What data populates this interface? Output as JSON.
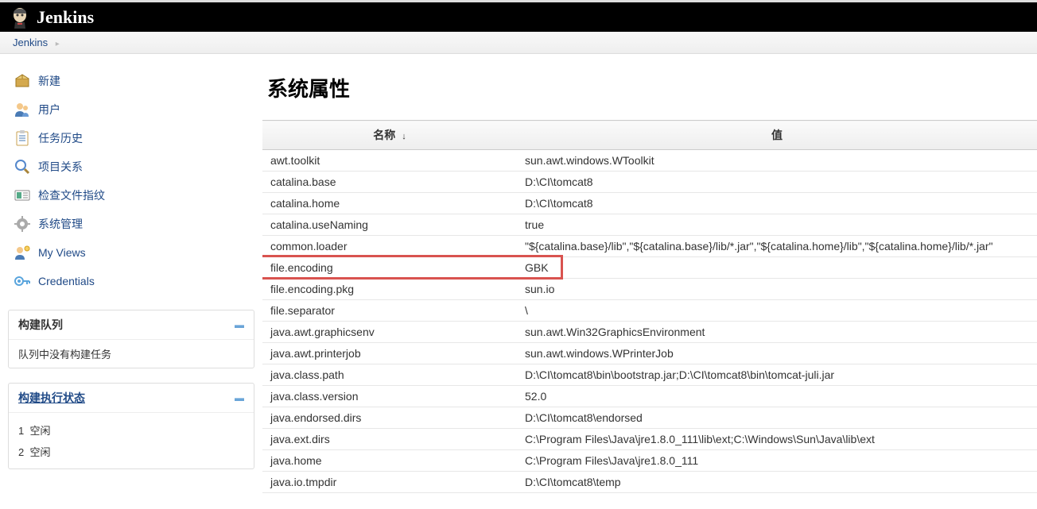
{
  "header": {
    "product_name": "Jenkins"
  },
  "breadcrumb": {
    "items": [
      "Jenkins"
    ]
  },
  "sidebar": {
    "items": [
      {
        "label": "新建",
        "icon": "box"
      },
      {
        "label": "用户",
        "icon": "users"
      },
      {
        "label": "任务历史",
        "icon": "clipboard"
      },
      {
        "label": "项目关系",
        "icon": "search"
      },
      {
        "label": "检查文件指纹",
        "icon": "fingerprint"
      },
      {
        "label": "系统管理",
        "icon": "gear"
      },
      {
        "label": "My Views",
        "icon": "myview"
      },
      {
        "label": "Credentials",
        "icon": "key"
      }
    ]
  },
  "panels": {
    "build_queue": {
      "title": "构建队列",
      "empty_msg": "队列中没有构建任务"
    },
    "executors": {
      "title": "构建执行状态",
      "rows": [
        {
          "num": "1",
          "state": "空闲"
        },
        {
          "num": "2",
          "state": "空闲"
        }
      ]
    }
  },
  "main": {
    "title": "系统属性",
    "columns": {
      "name": "名称",
      "value": "值"
    },
    "sort_indicator": "↓",
    "rows": [
      {
        "name": "awt.toolkit",
        "value": "sun.awt.windows.WToolkit"
      },
      {
        "name": "catalina.base",
        "value": "D:\\CI\\tomcat8"
      },
      {
        "name": "catalina.home",
        "value": "D:\\CI\\tomcat8"
      },
      {
        "name": "catalina.useNaming",
        "value": "true"
      },
      {
        "name": "common.loader",
        "value": "\"${catalina.base}/lib\",\"${catalina.base}/lib/*.jar\",\"${catalina.home}/lib\",\"${catalina.home}/lib/*.jar\""
      },
      {
        "name": "file.encoding",
        "value": "GBK",
        "highlighted": true
      },
      {
        "name": "file.encoding.pkg",
        "value": "sun.io"
      },
      {
        "name": "file.separator",
        "value": "\\"
      },
      {
        "name": "java.awt.graphicsenv",
        "value": "sun.awt.Win32GraphicsEnvironment"
      },
      {
        "name": "java.awt.printerjob",
        "value": "sun.awt.windows.WPrinterJob"
      },
      {
        "name": "java.class.path",
        "value": "D:\\CI\\tomcat8\\bin\\bootstrap.jar;D:\\CI\\tomcat8\\bin\\tomcat-juli.jar"
      },
      {
        "name": "java.class.version",
        "value": "52.0"
      },
      {
        "name": "java.endorsed.dirs",
        "value": "D:\\CI\\tomcat8\\endorsed"
      },
      {
        "name": "java.ext.dirs",
        "value": "C:\\Program Files\\Java\\jre1.8.0_111\\lib\\ext;C:\\Windows\\Sun\\Java\\lib\\ext"
      },
      {
        "name": "java.home",
        "value": "C:\\Program Files\\Java\\jre1.8.0_111"
      },
      {
        "name": "java.io.tmpdir",
        "value": "D:\\CI\\tomcat8\\temp"
      }
    ]
  }
}
